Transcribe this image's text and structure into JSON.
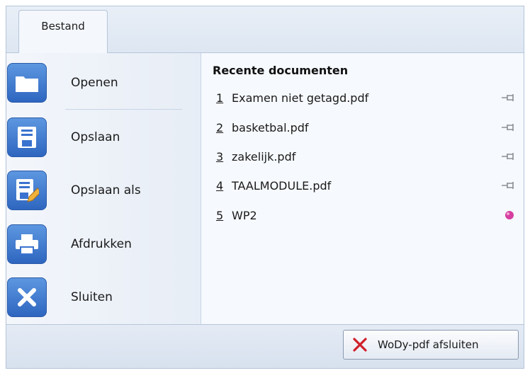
{
  "tab": {
    "label": "Bestand"
  },
  "menu": [
    {
      "label": "Openen",
      "icon": "folder-icon"
    },
    {
      "label": "Opslaan",
      "icon": "save-icon"
    },
    {
      "label": "Opslaan als",
      "icon": "save-as-icon"
    },
    {
      "label": "Afdrukken",
      "icon": "printer-icon"
    },
    {
      "label": "Sluiten",
      "icon": "close-icon"
    }
  ],
  "recent": {
    "title": "Recente documenten",
    "items": [
      {
        "num": "1",
        "name": "Examen niet getagd.pdf",
        "pinned": false
      },
      {
        "num": "2",
        "name": "basketbal.pdf",
        "pinned": false
      },
      {
        "num": "3",
        "name": "zakelijk.pdf",
        "pinned": false
      },
      {
        "num": "4",
        "name": "TAALMODULE.pdf",
        "pinned": false
      },
      {
        "num": "5",
        "name": "WP2",
        "pinned": true
      }
    ]
  },
  "footer": {
    "exit_label": "WoDy-pdf afsluiten"
  },
  "colors": {
    "accent": "#3a73cf",
    "pin_active": "#d63fa0",
    "exit_x": "#d0202a"
  }
}
